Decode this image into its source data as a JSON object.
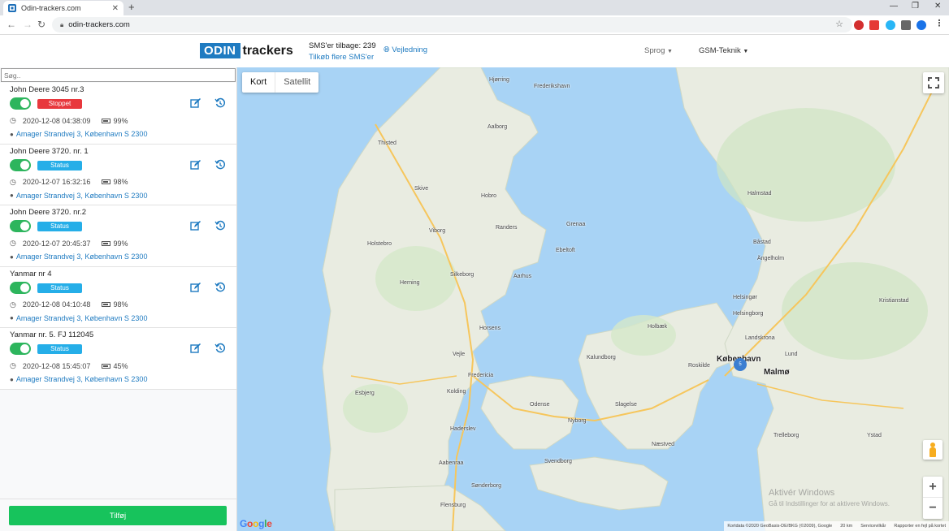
{
  "browser": {
    "tab_title": "Odin-trackers.com",
    "tab_close": "✕",
    "new_tab": "+",
    "url": "odin-trackers.com",
    "nav": {
      "back": "←",
      "forward": "→",
      "reload": "↻"
    },
    "window_controls": {
      "minimize": "—",
      "restore": "❐",
      "close": "✕"
    }
  },
  "header": {
    "logo_odin": "ODIN",
    "logo_trackers": "trackers",
    "sms_label": "SMS'er tilbage: 239",
    "sms_link": "Tilkøb flere SMS'er",
    "guide_label": "Vejledning",
    "language_label": "Sprog",
    "company_label": "GSM-Teknik"
  },
  "sidebar": {
    "search_placeholder": "Søg..",
    "add_button": "Tilføj",
    "trackers": [
      {
        "name": "John Deere 3045 nr.3",
        "status": "Stoppet",
        "status_color": "#e8383d",
        "timestamp": "2020-12-08 04:38:09",
        "battery": "99%",
        "address": "Amager Strandvej 3, København S 2300"
      },
      {
        "name": "John Deere 3720. nr. 1",
        "status": "Status",
        "status_color": "#25aee8",
        "timestamp": "2020-12-07 16:32:16",
        "battery": "98%",
        "address": "Amager Strandvej 3, København S 2300"
      },
      {
        "name": "John Deere 3720. nr.2",
        "status": "Status",
        "status_color": "#25aee8",
        "timestamp": "2020-12-07 20:45:37",
        "battery": "99%",
        "address": "Amager Strandvej 3, København S 2300"
      },
      {
        "name": "Yanmar nr 4",
        "status": "Status",
        "status_color": "#25aee8",
        "timestamp": "2020-12-08 04:10:48",
        "battery": "98%",
        "address": "Amager Strandvej 3, København S 2300"
      },
      {
        "name": "Yanmar nr. 5. FJ 112045",
        "status": "Status",
        "status_color": "#25aee8",
        "timestamp": "2020-12-08 15:45:07",
        "battery": "45%",
        "address": "Amager Strandvej 3, København S 2300"
      }
    ]
  },
  "map": {
    "type_map": "Kort",
    "type_satellite": "Satellit",
    "google_logo": "Google",
    "cluster_count": "5",
    "attribution": "Kortdata ©2020 GeoBasis-DE/BKG (©2009), Google",
    "scale": "20 km",
    "terms": "Servicevilkår",
    "report": "Rapporter en fejl på kortet",
    "watermark_title": "Aktivér Windows",
    "watermark_sub": "Gå til Indstillinger for at aktivere Windows.",
    "cities": [
      {
        "name": "Aalborg"
      },
      {
        "name": "Randers"
      },
      {
        "name": "Aarhus"
      },
      {
        "name": "Viborg"
      },
      {
        "name": "Herning"
      },
      {
        "name": "Silkeborg"
      },
      {
        "name": "Horsens"
      },
      {
        "name": "Vejle"
      },
      {
        "name": "Kolding"
      },
      {
        "name": "Fredericia"
      },
      {
        "name": "Esbjerg"
      },
      {
        "name": "Odense"
      },
      {
        "name": "Svendborg"
      },
      {
        "name": "Sønderborg"
      },
      {
        "name": "Flensburg"
      },
      {
        "name": "Haderslev"
      },
      {
        "name": "Aabenraa"
      },
      {
        "name": "Slagelse"
      },
      {
        "name": "Næstved"
      },
      {
        "name": "Roskilde"
      },
      {
        "name": "Helsingør"
      },
      {
        "name": "Helsingborg"
      },
      {
        "name": "København",
        "big": true
      },
      {
        "name": "Malmø",
        "big": true
      },
      {
        "name": "Lund"
      },
      {
        "name": "Halmstad"
      },
      {
        "name": "Kristianstad"
      },
      {
        "name": "Hjørring"
      },
      {
        "name": "Frederikshavn"
      },
      {
        "name": "Thisted"
      },
      {
        "name": "Skive"
      },
      {
        "name": "Holstebro"
      },
      {
        "name": "Hobro"
      },
      {
        "name": "Grenaa"
      },
      {
        "name": "Ebeltoft"
      },
      {
        "name": "Kalundborg"
      },
      {
        "name": "Holbæk"
      },
      {
        "name": "Nyborg"
      },
      {
        "name": "Trelleborg"
      },
      {
        "name": "Ystad"
      },
      {
        "name": "Ängelholm"
      },
      {
        "name": "Landskrona"
      },
      {
        "name": "Båstad"
      }
    ]
  },
  "colors": {
    "brand": "#1f7bc1",
    "toggle_on": "#2db55d",
    "add_button": "#17c35c",
    "sea": "#a8d3f5",
    "land": "#e9ece1"
  }
}
